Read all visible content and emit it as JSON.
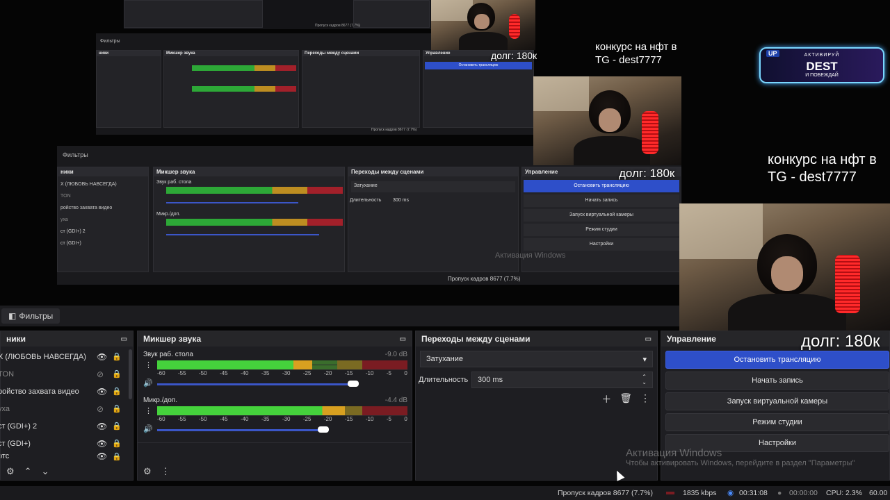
{
  "filters_tab": {
    "label": "Фильтры"
  },
  "sources": {
    "title": "ники",
    "items": [
      {
        "label": "Х (ЛЮБОВЬ НАВСЕГДА)",
        "visible": true
      },
      {
        "label": "TON",
        "visible": false
      },
      {
        "label": "ройство захвата видео",
        "visible": true
      },
      {
        "label": "уха",
        "visible": false
      },
      {
        "label": "ст (GDI+) 2",
        "visible": true
      },
      {
        "label": "ст (GDI+)",
        "visible": true
      },
      {
        "label": "ртс",
        "visible": true
      }
    ]
  },
  "mixer": {
    "title": "Микшер звука",
    "tracks": [
      {
        "name": "Звук раб. стола",
        "db": "-9.0 dB",
        "level": 0.62,
        "volume": 0.92
      },
      {
        "name": "Микр./доп.",
        "db": "-4.4 dB",
        "level": 0.75,
        "volume": 0.78
      }
    ],
    "scale": [
      "-60",
      "-55",
      "-50",
      "-45",
      "-40",
      "-35",
      "-30",
      "-25",
      "-20",
      "-15",
      "-10",
      "-5",
      "0"
    ]
  },
  "transitions": {
    "title": "Переходы между сценами",
    "selected": "Затухание",
    "duration_label": "Длительность",
    "duration_value": "300 ms"
  },
  "controls": {
    "title": "Управление",
    "stop_stream": "Остановить трансляцию",
    "start_record": "Начать запись",
    "virtual_cam": "Запуск виртуальной камеры",
    "studio_mode": "Режим студии",
    "settings": "Настройки"
  },
  "status": {
    "dropped": "Пропуск кадров 8677 (7.7%)",
    "kbps": "1835 kbps",
    "live_time": "00:31:08",
    "rec_time": "00:00:00",
    "cpu": "CPU: 2.3%",
    "fps": "60.00"
  },
  "watermark": {
    "title": "Активация Windows",
    "sub": "Чтобы активировать Windows, перейдите в раздел \"Параметры\""
  },
  "overlay": {
    "contest_line1": "конкурс на нфт в",
    "contest_line2": "TG - dest7777",
    "debt": "долг: 180к",
    "banner_up": "UP",
    "banner_activate": "АКТИВИРУЙ",
    "banner_dest": "DEST",
    "banner_win": "И ПОБЕЖДАЙ"
  },
  "colors": {
    "accent": "#2e4fc9",
    "meter_green": "#45d23c",
    "meter_yellow": "#d8a020",
    "meter_red": "#b8202a"
  }
}
